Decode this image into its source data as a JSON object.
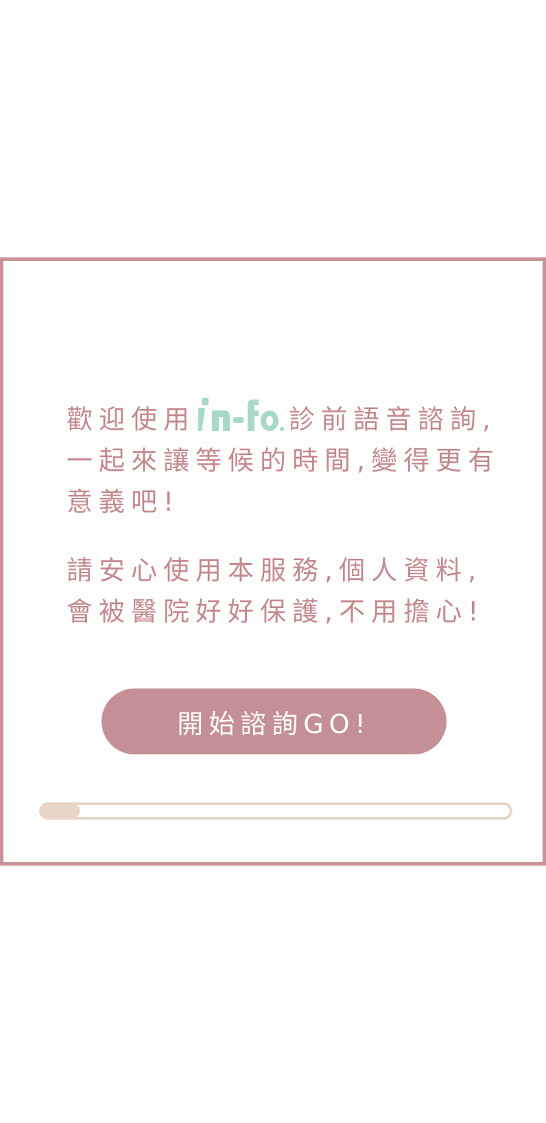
{
  "colors": {
    "frame": "#c89398",
    "text": "#c4888e",
    "button_bg": "#c49095",
    "button_text": "#ffffff",
    "logo": "#a8d8cb",
    "progress": "#e7d5c7"
  },
  "welcome": {
    "before_logo": "歡迎使用",
    "logo_text": "In-fo.",
    "after_logo": "診前語音諮詢,一起來讓等候的時間,變得更有意義吧!"
  },
  "privacy": {
    "text": "請安心使用本服務,個人資料,會被醫院好好保護,不用擔心!"
  },
  "button": {
    "label": "開始諮詢GO!"
  },
  "progress": {
    "value": 0.08
  }
}
